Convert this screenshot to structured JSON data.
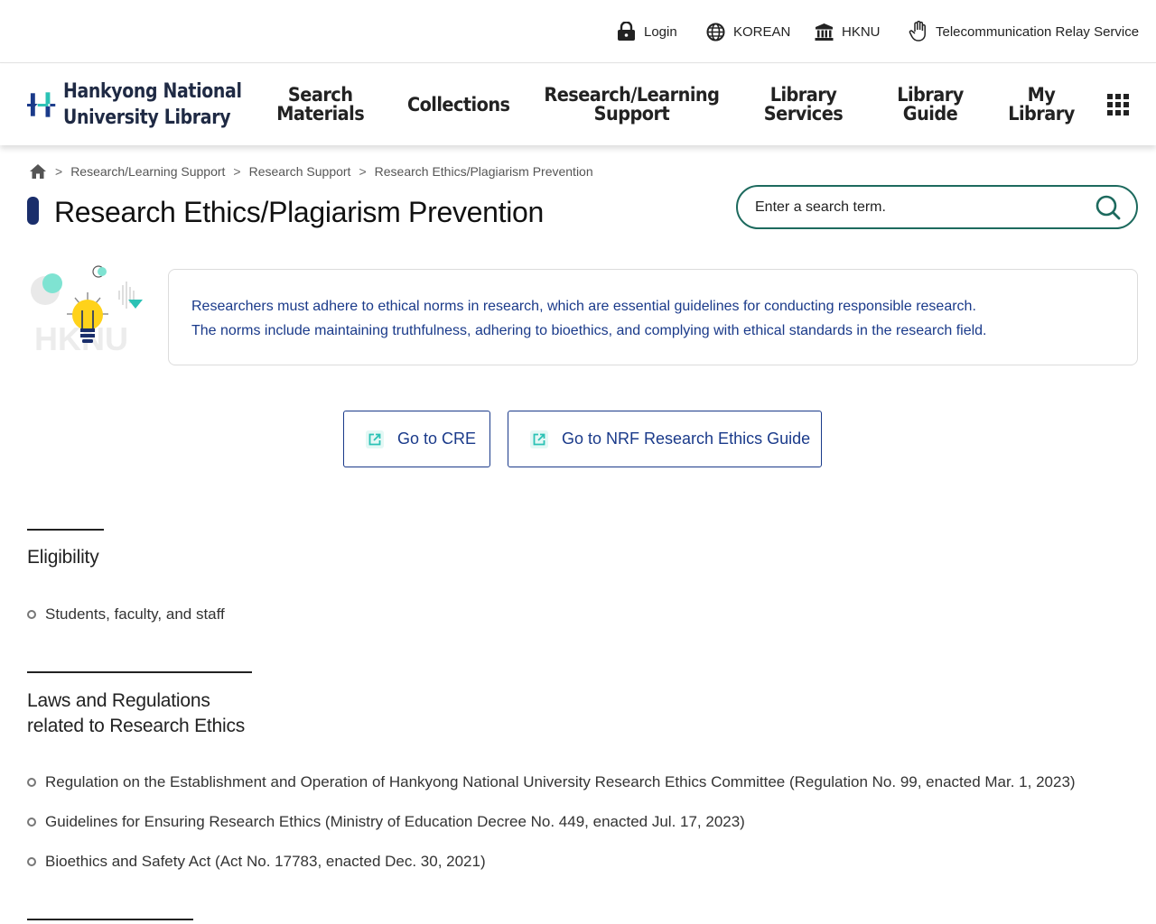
{
  "utility": {
    "login": "Login",
    "language": "KOREAN",
    "university": "HKNU",
    "relay": "Telecommunication Relay Service"
  },
  "logo": {
    "line1": "Hankyong National",
    "line2": "University Library"
  },
  "nav": {
    "search_materials": [
      "Search",
      "Materials"
    ],
    "collections": [
      "Collections"
    ],
    "research_support": [
      "Research/Learning",
      "Support"
    ],
    "library_services": [
      "Library",
      "Services"
    ],
    "library_guide": [
      "Library",
      "Guide"
    ],
    "my_library": [
      "My",
      "Library"
    ]
  },
  "breadcrumb": [
    "Research/Learning Support",
    "Research Support",
    "Research Ethics/Plagiarism Prevention"
  ],
  "page_title": "Research Ethics/Plagiarism Prevention",
  "search": {
    "placeholder": "Enter a search term."
  },
  "illustration_text": "HKNU",
  "intro": [
    "Researchers must adhere to ethical norms in research, which are essential guidelines for conducting responsible research.",
    "The norms include maintaining truthfulness, adhering to bioethics, and complying with ethical standards in the research field."
  ],
  "links": {
    "cre": "Go to CRE",
    "nrf": "Go to NRF Research Ethics Guide"
  },
  "sections": {
    "eligibility": {
      "heading": "Eligibility",
      "items": [
        "Students, faculty, and staff"
      ]
    },
    "laws": {
      "heading": [
        "Laws and Regulations",
        "related to Research Ethics"
      ],
      "items": [
        "Regulation on the Establishment and Operation of Hankyong National University Research Ethics Committee (Regulation No. 99, enacted Mar. 1, 2023)",
        "Guidelines for Ensuring Research Ethics (Ministry of Education Decree No. 449, enacted Jul. 17, 2023)",
        "Bioethics and Safety Act (Act No. 17783, enacted Dec. 30, 2021)"
      ]
    }
  },
  "colors": {
    "navy": "#1a2e6b",
    "link_blue": "#1a3a8a",
    "teal": "#1d6a5e",
    "icon_teal": "#2bc2b5"
  }
}
